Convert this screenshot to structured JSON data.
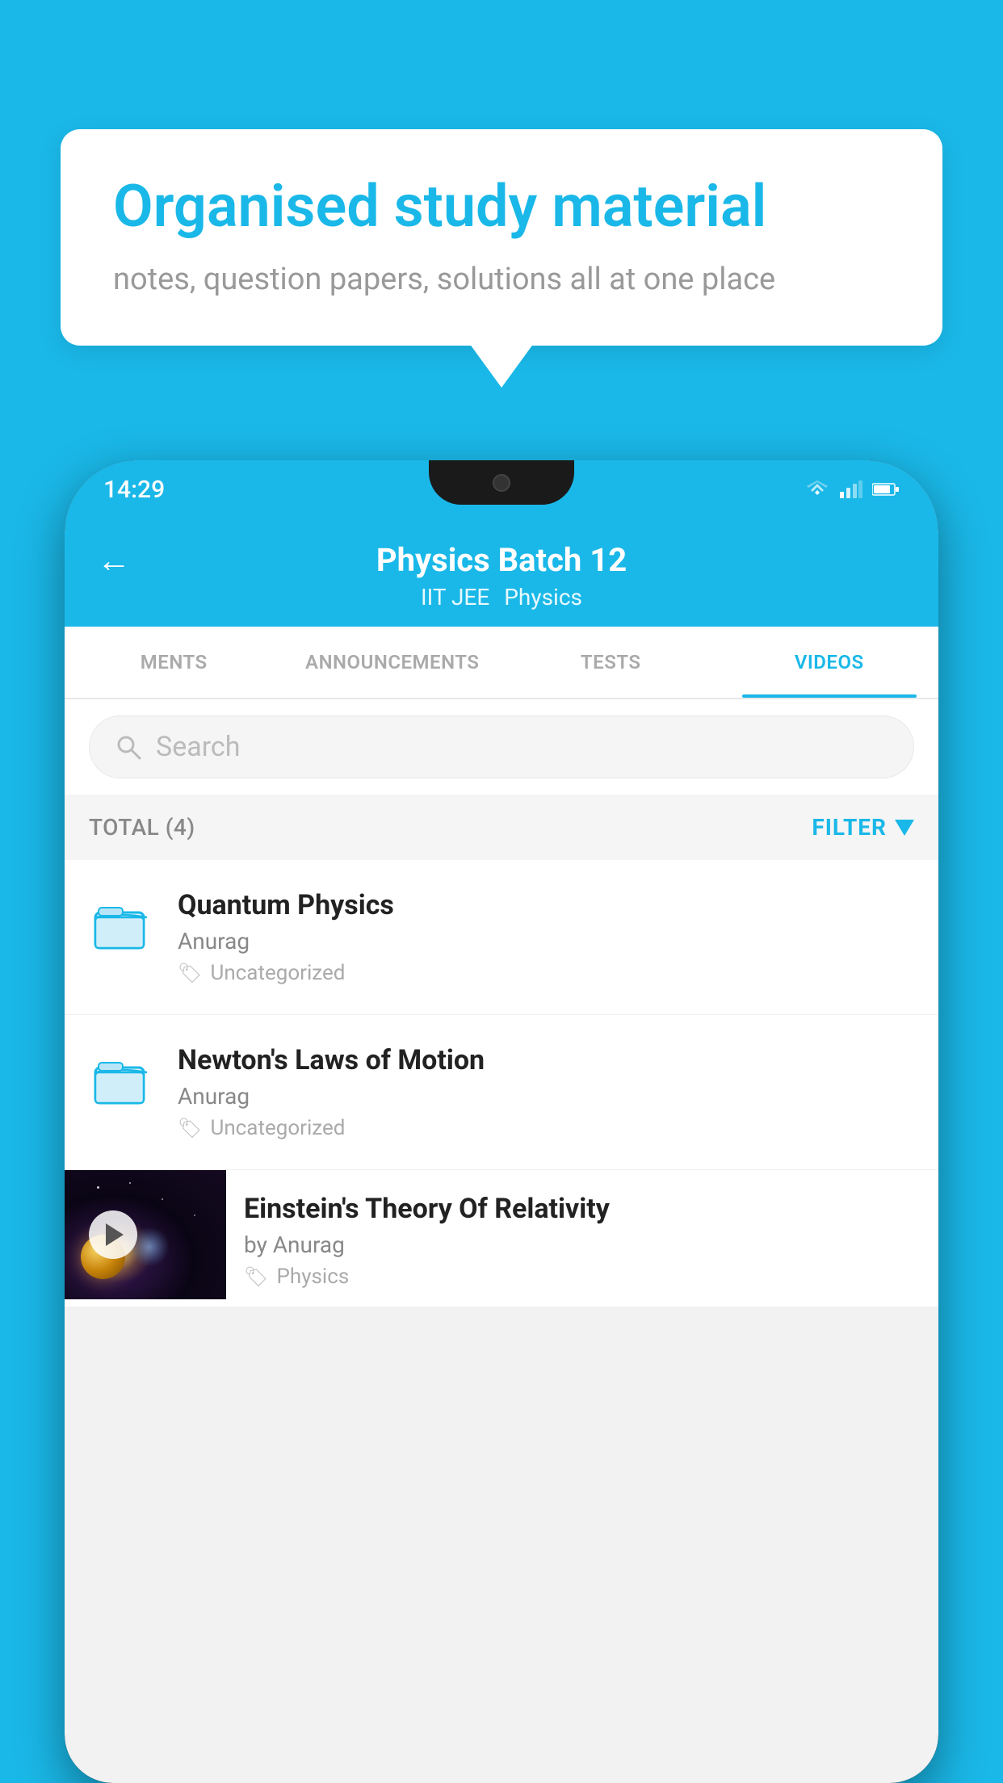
{
  "page": {
    "background_color": "#1ab8e8"
  },
  "speech_bubble": {
    "title": "Organised study material",
    "subtitle": "notes, question papers, solutions all at one place"
  },
  "status_bar": {
    "time": "14:29",
    "icons": [
      "wifi",
      "signal",
      "battery"
    ]
  },
  "app_header": {
    "title": "Physics Batch 12",
    "subtitle_part1": "IIT JEE",
    "subtitle_part2": "Physics",
    "back_icon": "←"
  },
  "tabs": [
    {
      "label": "MENTS",
      "active": false
    },
    {
      "label": "ANNOUNCEMENTS",
      "active": false
    },
    {
      "label": "TESTS",
      "active": false
    },
    {
      "label": "VIDEOS",
      "active": true
    }
  ],
  "search": {
    "placeholder": "Search"
  },
  "filter_bar": {
    "total_label": "TOTAL (4)",
    "filter_label": "FILTER"
  },
  "list_items": [
    {
      "id": 1,
      "title": "Quantum Physics",
      "author": "Anurag",
      "tag": "Uncategorized",
      "type": "folder"
    },
    {
      "id": 2,
      "title": "Newton's Laws of Motion",
      "author": "Anurag",
      "tag": "Uncategorized",
      "type": "folder"
    },
    {
      "id": 3,
      "title": "Einstein's Theory Of Relativity",
      "author_prefix": "by",
      "author": "Anurag",
      "tag": "Physics",
      "type": "video"
    }
  ]
}
